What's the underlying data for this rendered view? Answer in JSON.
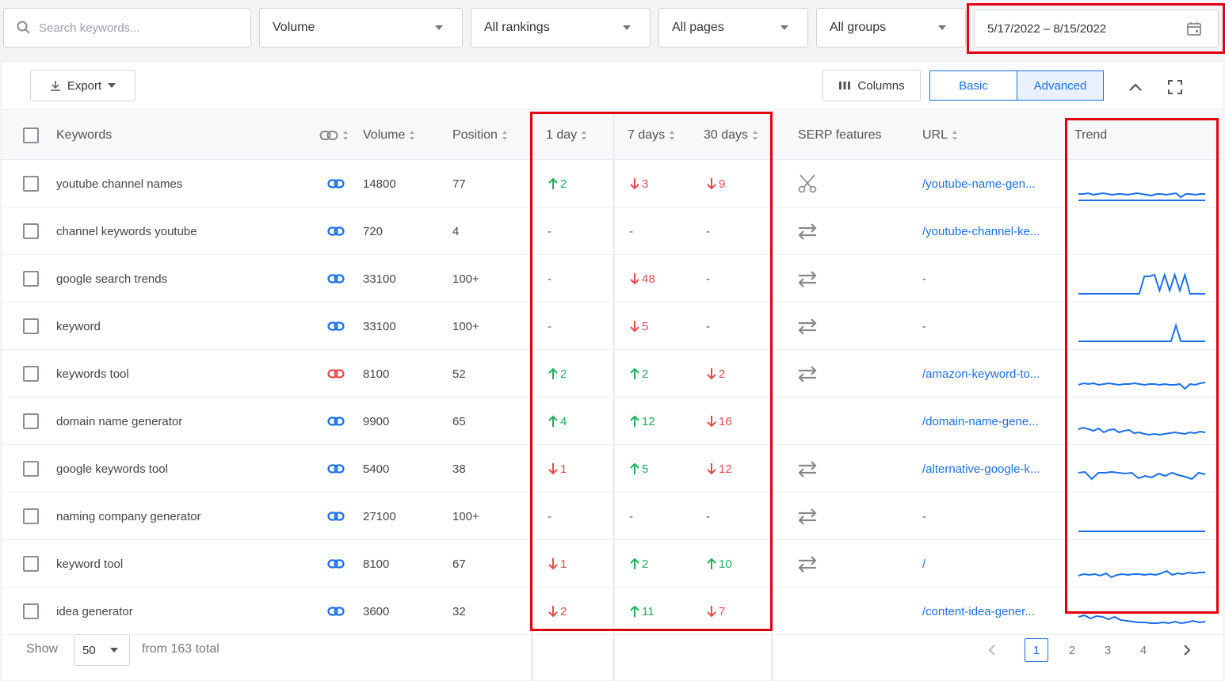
{
  "filters": {
    "search_placeholder": "Search keywords...",
    "volume": "Volume",
    "rankings": "All rankings",
    "pages": "All pages",
    "groups": "All groups",
    "date_range": "5/17/2022 – 8/15/2022"
  },
  "toolbar": {
    "export_label": "Export",
    "columns_label": "Columns",
    "basic_label": "Basic",
    "advanced_label": "Advanced"
  },
  "columns": {
    "keywords": "Keywords",
    "volume": "Volume",
    "position": "Position",
    "day1": "1 day",
    "day7": "7 days",
    "day30": "30 days",
    "serp": "SERP features",
    "url": "URL",
    "trend": "Trend"
  },
  "rows": [
    {
      "keyword": "youtube channel names",
      "link_color": "#1a6fe8",
      "volume": "14800",
      "position": "77",
      "d1": {
        "dir": "up",
        "val": "2"
      },
      "d7": {
        "dir": "down",
        "val": "3"
      },
      "d30": {
        "dir": "down",
        "val": "9"
      },
      "serp": "scissors-icon",
      "url": "/youtube-name-gen...",
      "trend": [
        [
          6,
          6,
          7,
          5,
          6,
          7,
          6,
          5,
          6,
          6,
          5,
          6,
          7,
          6,
          5,
          4,
          6,
          6,
          5,
          6,
          7,
          2,
          6,
          6,
          5,
          6,
          6
        ],
        [
          2,
          2,
          2,
          2,
          2,
          2,
          2,
          2,
          2,
          2,
          2,
          2,
          2,
          2,
          2,
          2,
          2,
          2,
          2,
          2
        ]
      ]
    },
    {
      "keyword": "channel keywords youtube",
      "link_color": "#1a6fe8",
      "volume": "720",
      "position": "4",
      "d1": {
        "dir": "none",
        "val": "-"
      },
      "d7": {
        "dir": "none",
        "val": "-"
      },
      "d30": {
        "dir": "none",
        "val": "-"
      },
      "serp": "swap-icon",
      "url": "/youtube-channel-ke...",
      "trend": []
    },
    {
      "keyword": "google search trends",
      "link_color": "#1a6fe8",
      "volume": "33100",
      "position": "100+",
      "d1": {
        "dir": "none",
        "val": "-"
      },
      "d7": {
        "dir": "down",
        "val": "48"
      },
      "d30": {
        "dir": "none",
        "val": "-"
      },
      "serp": "swap-icon",
      "url": "-",
      "trend": [
        [
          0,
          0,
          0,
          0,
          0,
          0,
          0,
          0,
          0,
          0,
          0,
          0,
          0,
          22,
          22,
          24,
          4,
          24,
          4,
          24,
          4,
          24,
          0,
          0,
          0,
          0
        ]
      ]
    },
    {
      "keyword": "keyword",
      "link_color": "#1a6fe8",
      "volume": "33100",
      "position": "100+",
      "d1": {
        "dir": "none",
        "val": "-"
      },
      "d7": {
        "dir": "down",
        "val": "5"
      },
      "d30": {
        "dir": "none",
        "val": "-"
      },
      "serp": "swap-icon",
      "url": "-",
      "trend": [
        [
          0,
          0,
          0,
          0,
          0,
          0,
          0,
          0,
          0,
          0,
          0,
          0,
          0,
          0,
          0,
          0,
          0,
          0,
          0,
          0,
          20,
          0,
          0,
          0,
          0,
          0,
          0
        ]
      ]
    },
    {
      "keyword": "keywords tool",
      "link_color": "#e34b4b",
      "volume": "8100",
      "position": "52",
      "d1": {
        "dir": "up",
        "val": "2"
      },
      "d7": {
        "dir": "up",
        "val": "2"
      },
      "d30": {
        "dir": "down",
        "val": "2"
      },
      "serp": "swap-icon",
      "url": "/amazon-keyword-to...",
      "trend": [
        [
          5,
          7,
          6,
          7,
          5,
          6,
          7,
          6,
          5,
          6,
          6,
          7,
          6,
          5,
          6,
          6,
          5,
          6,
          5,
          5,
          6,
          0,
          6,
          5,
          7,
          8
        ]
      ]
    },
    {
      "keyword": "domain name generator",
      "link_color": "#1a6fe8",
      "volume": "9900",
      "position": "65",
      "d1": {
        "dir": "up",
        "val": "4"
      },
      "d7": {
        "dir": "up",
        "val": "12"
      },
      "d30": {
        "dir": "down",
        "val": "16"
      },
      "serp": "",
      "url": "/domain-name-gene...",
      "trend": [
        [
          9,
          11,
          9,
          7,
          10,
          5,
          8,
          9,
          5,
          7,
          8,
          4,
          5,
          3,
          2,
          3,
          2,
          3,
          4,
          5,
          4,
          3,
          5,
          4,
          6,
          5
        ]
      ]
    },
    {
      "keyword": "google keywords tool",
      "link_color": "#1a6fe8",
      "volume": "5400",
      "position": "38",
      "d1": {
        "dir": "down",
        "val": "1"
      },
      "d7": {
        "dir": "up",
        "val": "5"
      },
      "d30": {
        "dir": "down",
        "val": "12"
      },
      "serp": "swap-icon",
      "url": "/alternative-google-k...",
      "trend": [
        [
          14,
          15,
          6,
          14,
          14,
          15,
          14,
          13,
          14,
          7,
          10,
          8,
          13,
          10,
          14,
          11,
          9,
          6,
          14,
          12
        ]
      ]
    },
    {
      "keyword": "naming company generator",
      "link_color": "#1a6fe8",
      "volume": "27100",
      "position": "100+",
      "d1": {
        "dir": "none",
        "val": "-"
      },
      "d7": {
        "dir": "none",
        "val": "-"
      },
      "d30": {
        "dir": "none",
        "val": "-"
      },
      "serp": "swap-icon",
      "url": "-",
      "trend": [
        [
          0,
          0,
          0,
          0,
          0,
          0,
          0,
          0,
          0,
          0
        ]
      ]
    },
    {
      "keyword": "keyword tool",
      "link_color": "#1a6fe8",
      "volume": "8100",
      "position": "67",
      "d1": {
        "dir": "down",
        "val": "1"
      },
      "d7": {
        "dir": "up",
        "val": "2"
      },
      "d30": {
        "dir": "up",
        "val": "10"
      },
      "serp": "swap-icon",
      "url": "/",
      "trend": [
        [
          4,
          6,
          5,
          6,
          4,
          7,
          2,
          5,
          6,
          5,
          6,
          6,
          5,
          6,
          5,
          7,
          10,
          5,
          7,
          6,
          8,
          7,
          8,
          8
        ]
      ]
    },
    {
      "keyword": "idea generator",
      "link_color": "#1a6fe8",
      "volume": "3600",
      "position": "32",
      "d1": {
        "dir": "down",
        "val": "2"
      },
      "d7": {
        "dir": "up",
        "val": "11"
      },
      "d30": {
        "dir": "down",
        "val": "7"
      },
      "serp": "",
      "url": "/content-idea-gener...",
      "trend": [
        [
          12,
          14,
          10,
          13,
          12,
          9,
          12,
          8,
          7,
          6,
          5,
          5,
          4,
          4,
          5,
          4,
          6,
          4,
          5,
          7,
          5,
          6
        ]
      ]
    }
  ],
  "footer": {
    "show_label": "Show",
    "per_page": "50",
    "total_label": "from 163 total",
    "pages": [
      "1",
      "2",
      "3",
      "4"
    ]
  }
}
